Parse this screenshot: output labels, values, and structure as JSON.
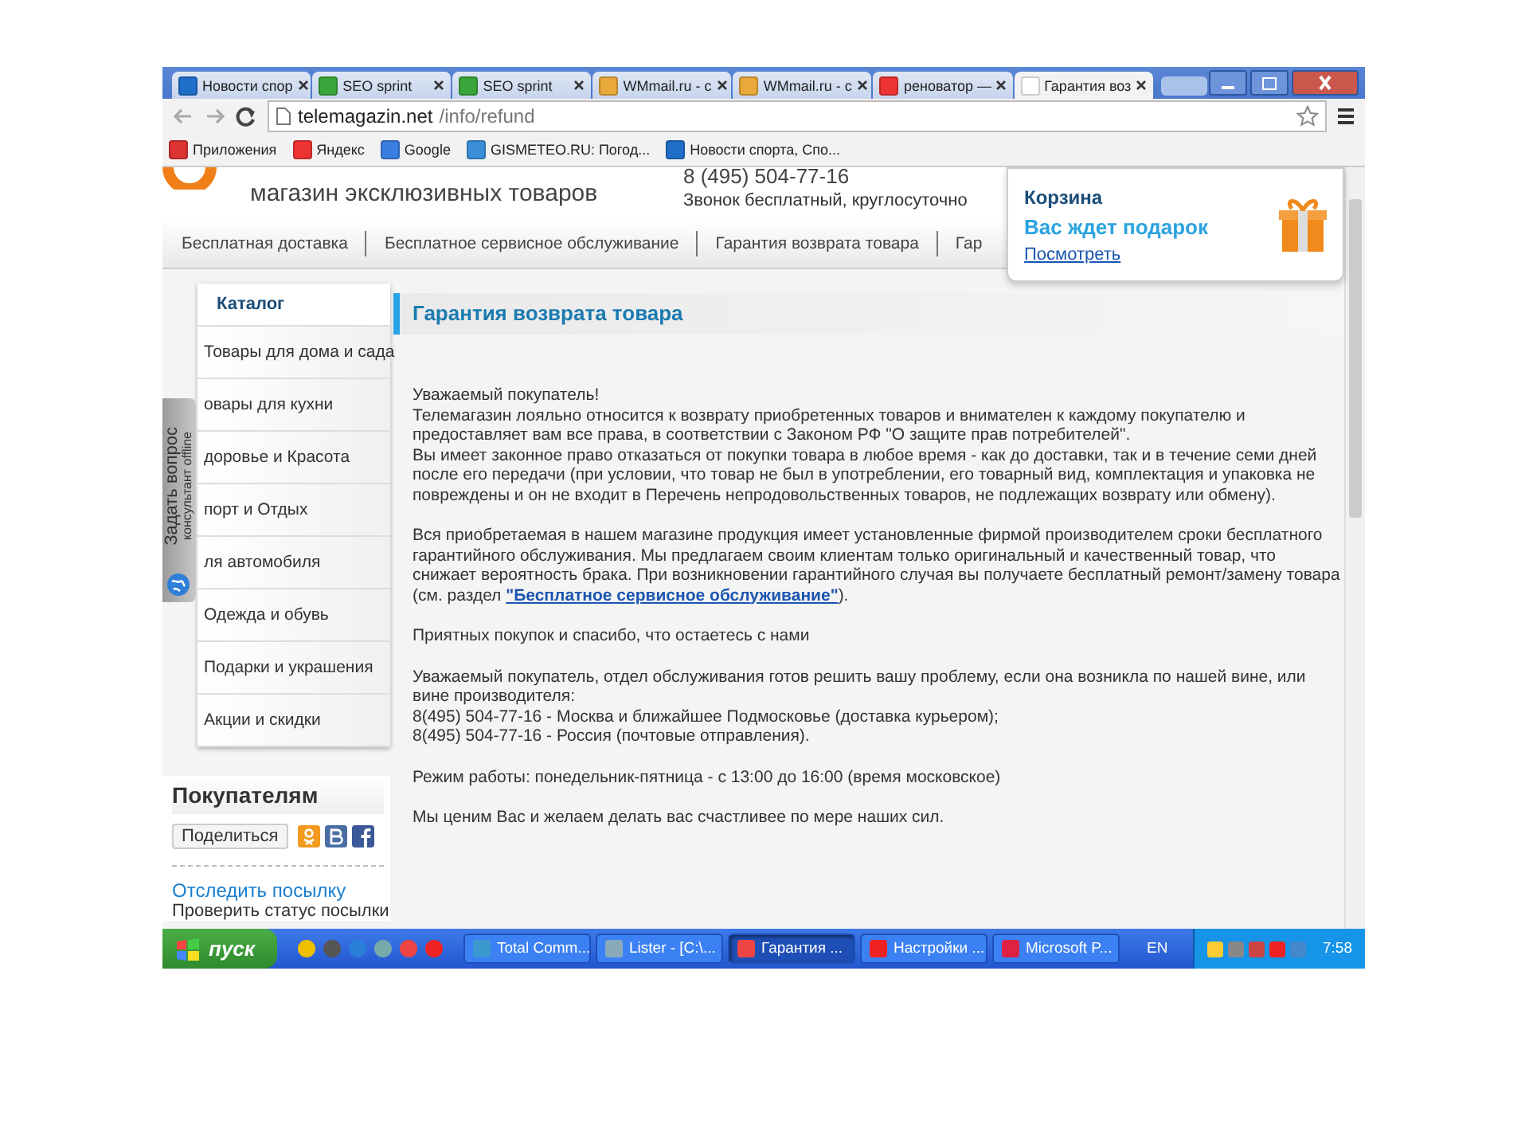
{
  "browser": {
    "tabs": [
      {
        "title": "Новости спор",
        "selected": false
      },
      {
        "title": "SEO sprint",
        "selected": false
      },
      {
        "title": "SEO sprint",
        "selected": false
      },
      {
        "title": "WMmail.ru - с",
        "selected": false
      },
      {
        "title": "WMmail.ru - с",
        "selected": false
      },
      {
        "title": "реноватор —",
        "selected": false
      },
      {
        "title": "Гарантия воз",
        "selected": true
      }
    ],
    "url_host": "telemagazin.net",
    "url_path": "/info/refund",
    "bookmarks": [
      "Приложения",
      "Яндекс",
      "Google",
      "GISMETEO.RU: Погод...",
      "Новости спорта, Спо..."
    ]
  },
  "header": {
    "phone": "8 (495) 504-77-16",
    "phone_note": "Звонок бесплатный, круглосуточно",
    "tagline": "магазин эксклюзивных товаров"
  },
  "nav": [
    "Бесплатная доставка",
    "Бесплатное сервисное обслуживание",
    "Гарантия возврата товара",
    "Гар"
  ],
  "cart": {
    "title": "Корзина",
    "promo": "Вас ждет подарок",
    "link": "Посмотреть"
  },
  "catalog": {
    "title": "Каталог",
    "items": [
      "Товары для дома и сада",
      "овары для кухни",
      "доровье и Красота",
      "порт и Отдых",
      "ля автомобиля",
      "Одежда и обувь",
      "Подарки и украшения",
      "Акции и скидки"
    ]
  },
  "ask_widget": {
    "title": "Задать вопрос",
    "status": "консультант offline"
  },
  "buyers": {
    "title": "Покупателям",
    "share": "Поделиться",
    "track_link": "Отследить посылку",
    "track_note": "Проверить статус посылки"
  },
  "article": {
    "heading": "Гарантия возврата товара",
    "paragraphs": [
      {
        "text": "Уважаемый покупатель!\nТелемагазин лояльно относится к возврату приобретенных товаров и внимателен к каждому покупателю и предоставляет вам все права, в соответствии с Законом РФ \"О защите прав потребителей\".\nВы имеет законное право отказаться от покупки товара в любое время - как до доставки, так и в течение семи дней после его передачи (при условии, что товар не был в употреблении, его товарный вид, комплектация и упаковка не повреждены и он не входит в Перечень непродовольственных товаров, не подлежащих возврату или обмену)."
      },
      {
        "text": "Вся приобретаемая в нашем магазине продукция имеет установленные фирмой производителем сроки бесплатного гарантийного обслуживания. Мы предлагаем своим клиентам только оригинальный и качественный товар, что снижает вероятность брака. При возникновении гарантийного случая вы получаете бесплатный ремонт/замену товара (см. раздел ",
        "link": "\"Бесплатное сервисное обслуживание\"",
        "after": ")."
      },
      {
        "text": "Приятных покупок и спасибо, что остаетесь с нами"
      },
      {
        "text": "Уважаемый покупатель, отдел обслуживания готов решить вашу проблему, если она возникла по нашей вине, или вине производителя:\n8(495) 504-77-16 - Москва и ближайшее Подмосковье (доставка курьером);\n8(495) 504-77-16 - Россия (почтовые отправления)."
      },
      {
        "text": "Режим работы: понедельник-пятница - с 13:00 до 16:00 (время московское)"
      },
      {
        "text": "Мы ценим Вас и желаем делать вас счастливее по мере наших сил."
      }
    ]
  },
  "taskbar": {
    "start": "пуск",
    "tasks": [
      {
        "label": "Total Comm...",
        "selected": false
      },
      {
        "label": "Lister - [C:\\...",
        "selected": false
      },
      {
        "label": "Гарантия ...",
        "selected": true
      },
      {
        "label": "Настройки ...",
        "selected": false
      },
      {
        "label": "Microsoft P...",
        "selected": false
      }
    ],
    "language": "EN",
    "clock": "7:58"
  }
}
